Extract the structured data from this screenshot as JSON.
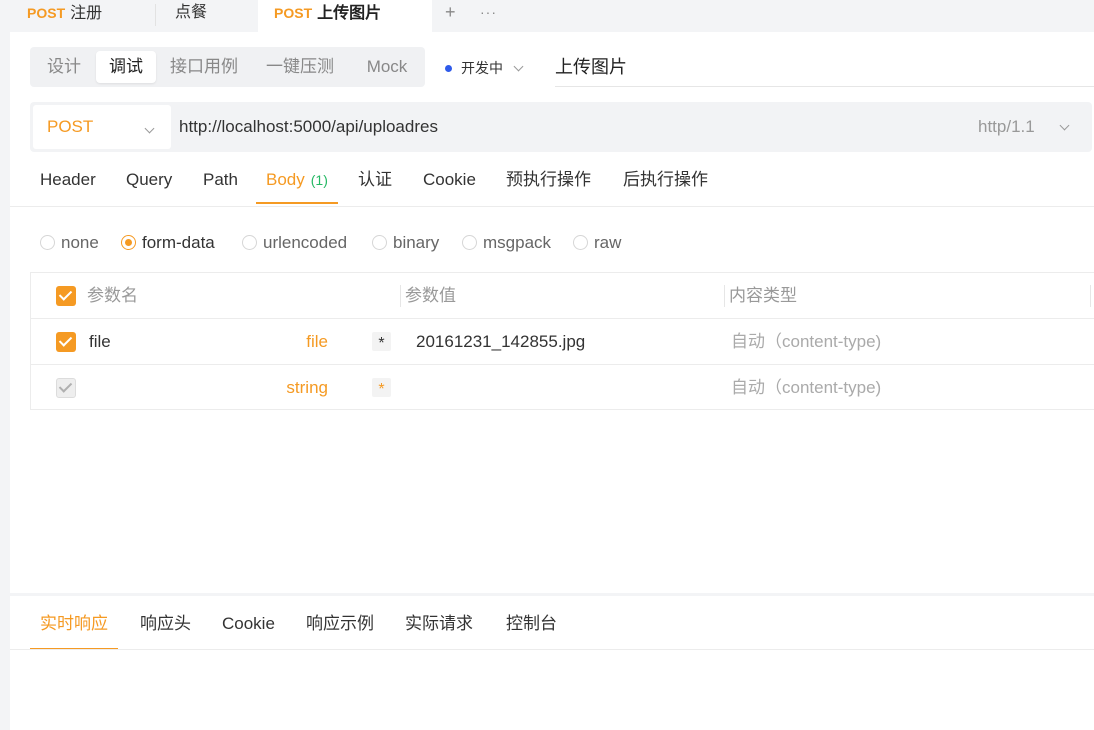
{
  "tabs": [
    {
      "method": "POST",
      "name": "注册"
    },
    {
      "method": "",
      "name": "点餐"
    },
    {
      "method": "POST",
      "name": "上传图片"
    }
  ],
  "tab_actions": {
    "add": "+",
    "more": "···"
  },
  "modes": [
    "设计",
    "调试",
    "接口用例",
    "一键压测",
    "Mock"
  ],
  "status": "开发中",
  "api_name": "上传图片",
  "request": {
    "method": "POST",
    "url": "http://localhost:5000/api/uploadres",
    "protocol": "http/1.1"
  },
  "request_tabs": [
    {
      "label": "Header"
    },
    {
      "label": "Query"
    },
    {
      "label": "Path"
    },
    {
      "label": "Body",
      "badge": "(1)"
    },
    {
      "label": "认证"
    },
    {
      "label": "Cookie"
    },
    {
      "label": "预执行操作"
    },
    {
      "label": "后执行操作"
    }
  ],
  "body_types": [
    "none",
    "form-data",
    "urlencoded",
    "binary",
    "msgpack",
    "raw"
  ],
  "body_selected": "form-data",
  "params": {
    "headers": {
      "name": "参数名",
      "value": "参数值",
      "content_type": "内容类型"
    },
    "rows": [
      {
        "name": "file",
        "type": "file",
        "required": "*",
        "value": "20161231_142855.jpg",
        "content_type": "自动（content-type)"
      },
      {
        "name": "",
        "type": "string",
        "required": "*",
        "value": "",
        "content_type": "自动（content-type)"
      }
    ]
  },
  "response_tabs": [
    "实时响应",
    "响应头",
    "Cookie",
    "响应示例",
    "实际请求",
    "控制台"
  ],
  "colors": {
    "accent": "#f59a23",
    "status_dot": "#2f5bea",
    "badge": "#25b864"
  }
}
